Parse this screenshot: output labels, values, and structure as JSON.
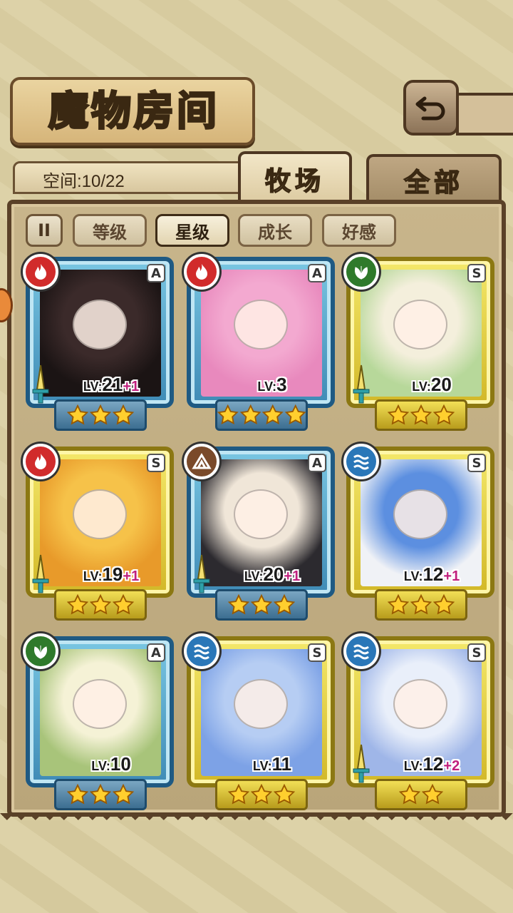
{
  "header": {
    "title": "魔物房间"
  },
  "space": {
    "label": "空间:10/22"
  },
  "tabs": {
    "ranch": "牧场",
    "all": "全部"
  },
  "filters": {
    "pause": "II",
    "level": "等级",
    "star": "星级",
    "growth": "成长",
    "affection": "好感",
    "active": "星级"
  },
  "colors": {
    "fire": "#d12b2b",
    "grass": "#2f7a2b",
    "water": "#2a77b8",
    "earth": "#7a4a2a",
    "rank_A": "#3f8bb6",
    "rank_S": "#d2b828",
    "bonus": "#c0207e"
  },
  "monsters": [
    {
      "grade": "A",
      "element": "fire",
      "level": "21",
      "bonus": "+1",
      "stars": 3,
      "has_sword": true,
      "palette": [
        "#3b2a2a",
        "#1b1414"
      ]
    },
    {
      "grade": "A",
      "element": "fire",
      "level": "3",
      "bonus": "",
      "stars": 4,
      "has_sword": false,
      "palette": [
        "#f3a9d0",
        "#e889bd"
      ]
    },
    {
      "grade": "S",
      "element": "grass",
      "level": "20",
      "bonus": "",
      "stars": 3,
      "has_sword": true,
      "palette": [
        "#f4efdc",
        "#b7d89a"
      ]
    },
    {
      "grade": "S",
      "element": "fire",
      "level": "19",
      "bonus": "+1",
      "stars": 3,
      "has_sword": true,
      "palette": [
        "#f6c249",
        "#e89a2a"
      ]
    },
    {
      "grade": "A",
      "element": "earth",
      "level": "20",
      "bonus": "+1",
      "stars": 3,
      "has_sword": true,
      "palette": [
        "#f0e6d8",
        "#2c2a2f"
      ]
    },
    {
      "grade": "S",
      "element": "water",
      "level": "12",
      "bonus": "+1",
      "stars": 3,
      "has_sword": false,
      "palette": [
        "#5c8fe0",
        "#f0f2f6"
      ]
    },
    {
      "grade": "A",
      "element": "grass",
      "level": "10",
      "bonus": "",
      "stars": 3,
      "has_sword": false,
      "palette": [
        "#f5f2d6",
        "#a8c47a"
      ]
    },
    {
      "grade": "S",
      "element": "water",
      "level": "11",
      "bonus": "",
      "stars": 3,
      "has_sword": false,
      "palette": [
        "#b6cdf3",
        "#7da2e6"
      ]
    },
    {
      "grade": "S",
      "element": "water",
      "level": "12",
      "bonus": "+2",
      "stars": 2,
      "has_sword": true,
      "palette": [
        "#e9effa",
        "#9fb6e8"
      ]
    }
  ]
}
